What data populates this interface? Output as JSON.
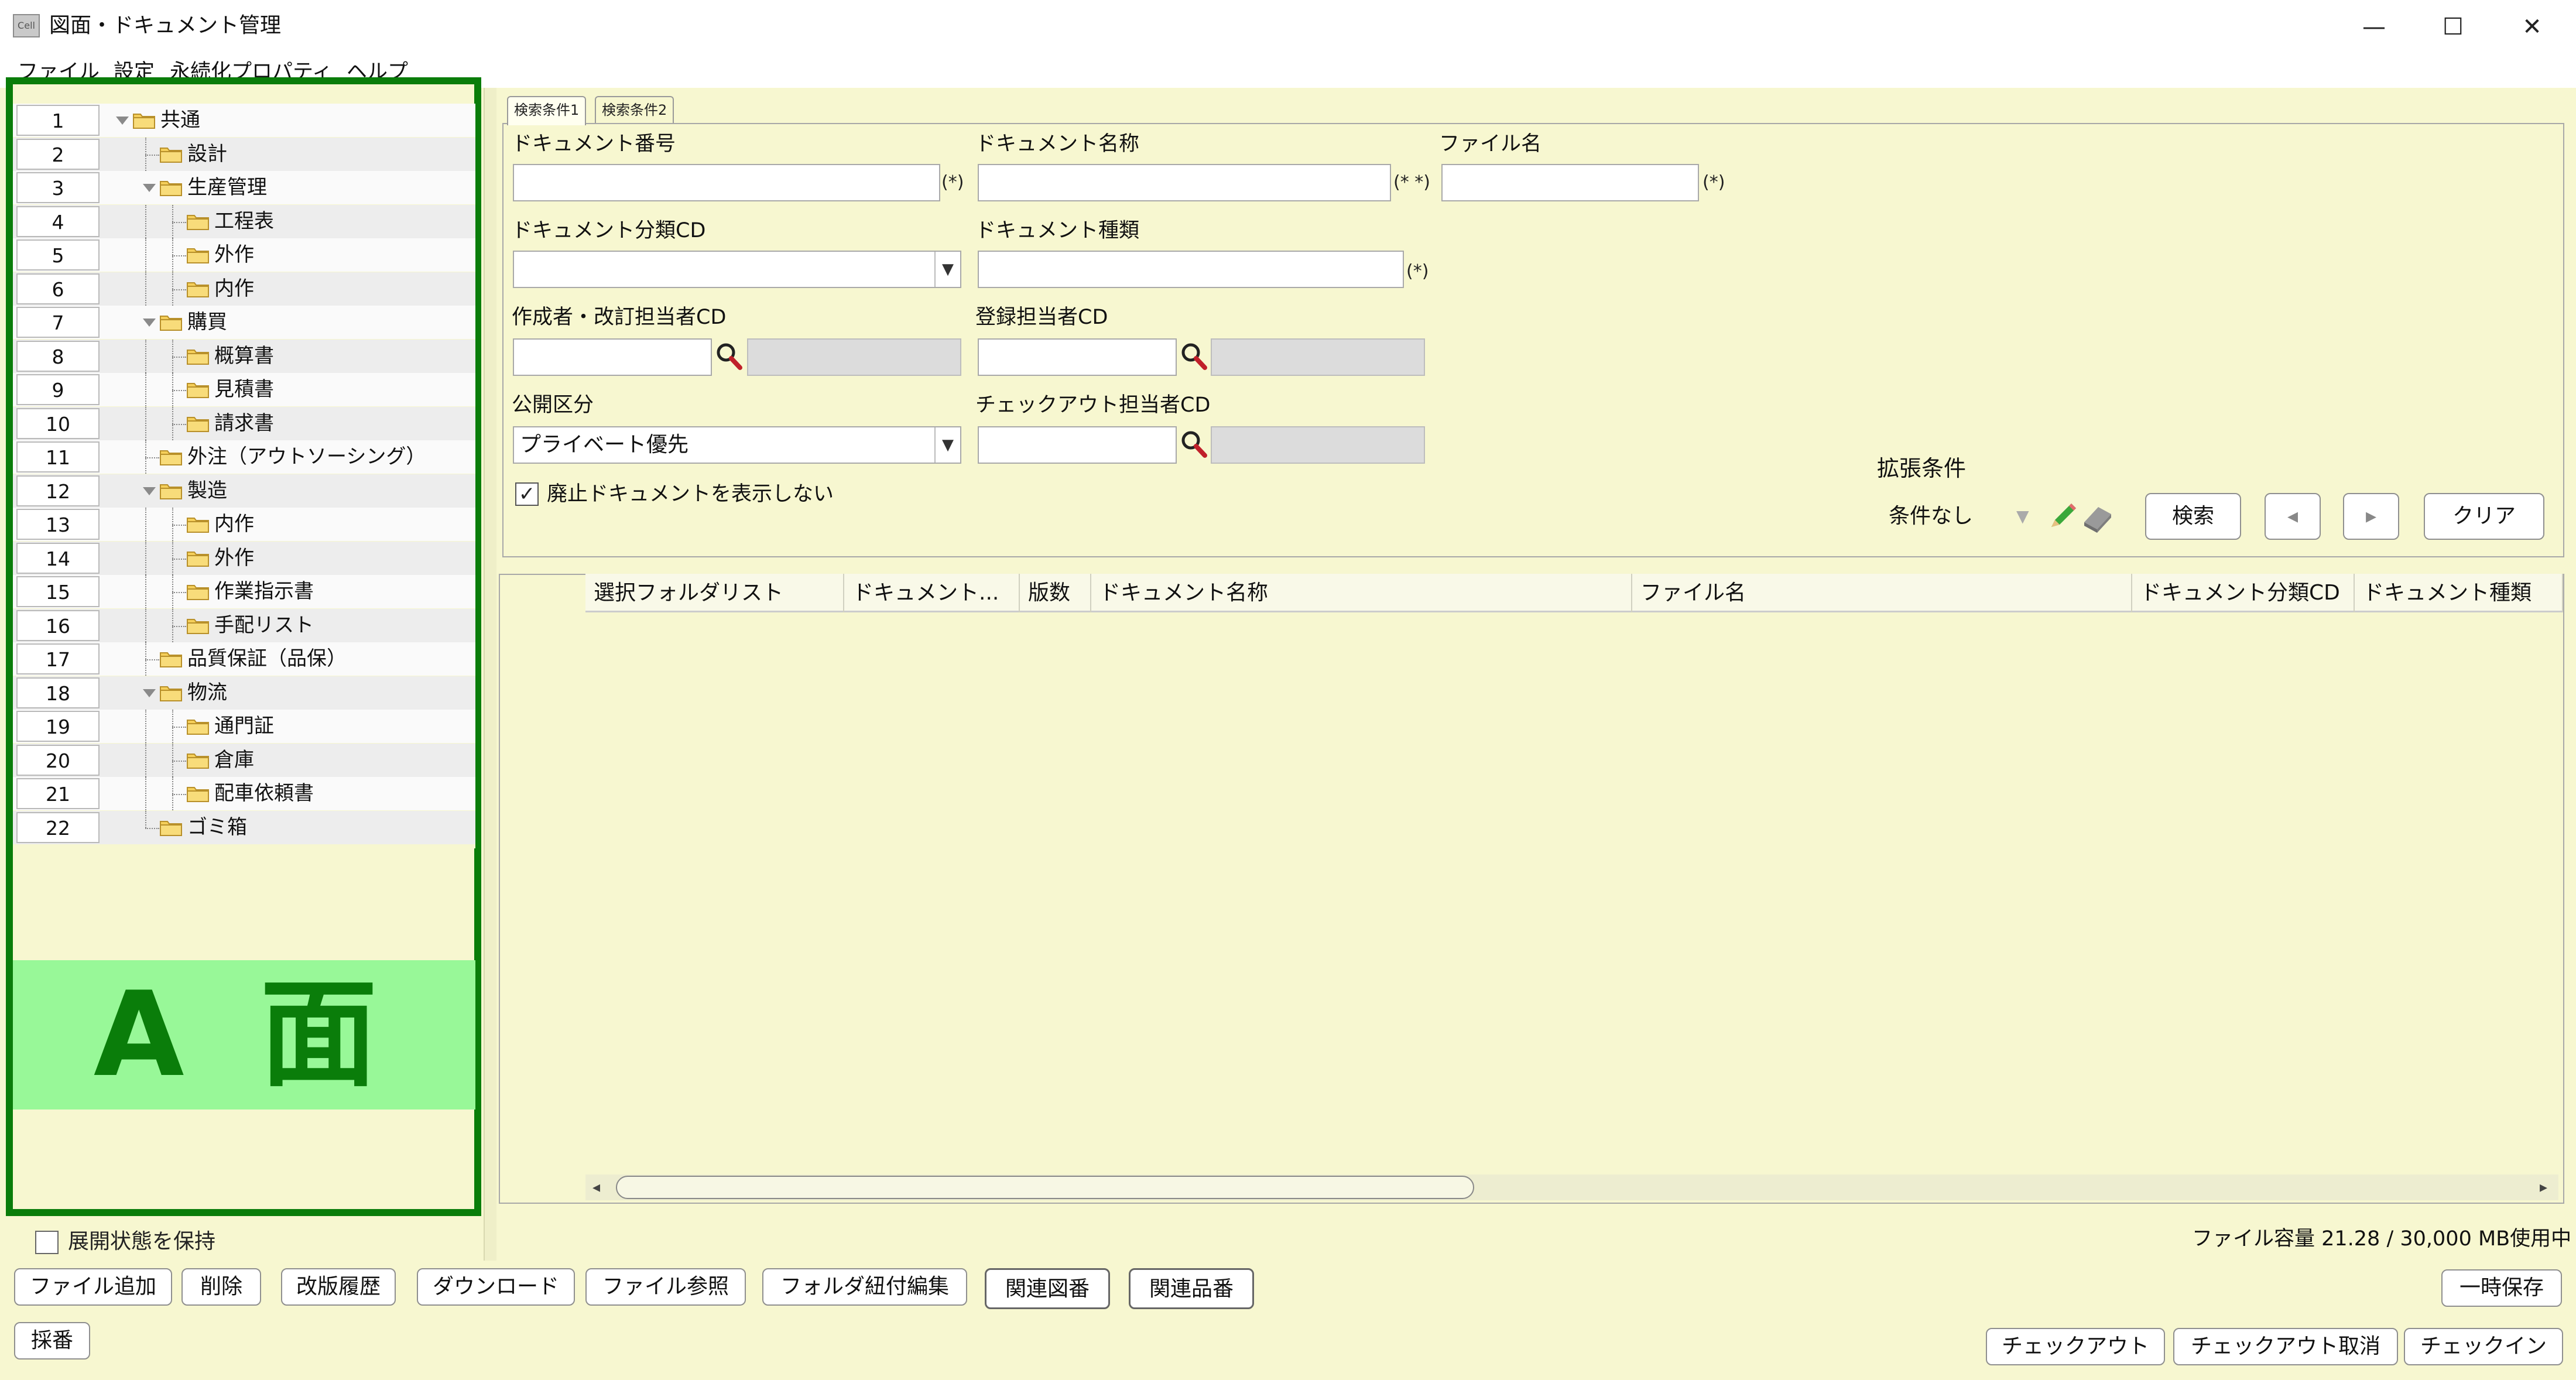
{
  "window": {
    "icon_text": "Cell",
    "title": "図面・ドキュメント管理",
    "minimize": "—",
    "maximize": "☐",
    "close": "✕"
  },
  "menu": [
    "ファイル",
    "設定",
    "永続化プロパティ",
    "ヘルプ"
  ],
  "tree": {
    "rows": [
      {
        "num": "1",
        "label": "共通"
      },
      {
        "num": "2",
        "label": "設計"
      },
      {
        "num": "3",
        "label": "生産管理"
      },
      {
        "num": "4",
        "label": "工程表"
      },
      {
        "num": "5",
        "label": "外作"
      },
      {
        "num": "6",
        "label": "内作"
      },
      {
        "num": "7",
        "label": "購買"
      },
      {
        "num": "8",
        "label": "概算書"
      },
      {
        "num": "9",
        "label": "見積書"
      },
      {
        "num": "10",
        "label": "請求書"
      },
      {
        "num": "11",
        "label": "外注（アウトソーシング）"
      },
      {
        "num": "12",
        "label": "製造"
      },
      {
        "num": "13",
        "label": "内作"
      },
      {
        "num": "14",
        "label": "外作"
      },
      {
        "num": "15",
        "label": "作業指示書"
      },
      {
        "num": "16",
        "label": "手配リスト"
      },
      {
        "num": "17",
        "label": "品質保証（品保）"
      },
      {
        "num": "18",
        "label": "物流"
      },
      {
        "num": "19",
        "label": "通門証"
      },
      {
        "num": "20",
        "label": "倉庫"
      },
      {
        "num": "21",
        "label": "配車依頼書"
      },
      {
        "num": "22",
        "label": "ゴミ箱"
      }
    ],
    "keep_expand_label": "展開状態を保持"
  },
  "side_label": "A 面",
  "search": {
    "tabs": [
      "検索条件1",
      "検索条件2"
    ],
    "doc_number_label": "ドキュメント番号",
    "doc_name_label": "ドキュメント名称",
    "file_name_label": "ファイル名",
    "doc_class_label": "ドキュメント分類CD",
    "doc_type_label": "ドキュメント種類",
    "author_label": "作成者・改訂担当者CD",
    "registrant_label": "登録担当者CD",
    "publish_label": "公開区分",
    "publish_value": "プライベート優先",
    "checkout_user_label": "チェックアウト担当者CD",
    "hint_single": "(*)",
    "hint_double": "(* *)",
    "hide_obsolete_label": "廃止ドキュメントを表示しない",
    "hide_obsolete_checked": "✓",
    "ext_condition_label": "拡張条件",
    "ext_condition_value": "条件なし",
    "search_button": "検索",
    "prev_button": "◂",
    "next_button": "▸",
    "clear_button": "クリア"
  },
  "results": {
    "columns": [
      "選択フォルダリスト",
      "ドキュメント...",
      "版数",
      "ドキュメント名称",
      "ファイル名",
      "ドキュメント分類CD",
      "ドキュメント種類"
    ]
  },
  "capacity_text": "ファイル容量  21.28  /  30,000  MB使用中",
  "buttons": {
    "add_file": "ファイル追加",
    "delete": "削除",
    "revision_history": "改版履歴",
    "download": "ダウンロード",
    "file_reference": "ファイル参照",
    "folder_link_edit": "フォルダ紐付編集",
    "related_drawing": "関連図番",
    "related_item": "関連品番",
    "temp_save": "一時保存",
    "numbering": "採番",
    "checkout": "チェックアウト",
    "checkout_cancel": "チェックアウト取消",
    "checkin": "チェックイン"
  },
  "colors": {
    "background": "#f7f7d0",
    "highlight_border": "#0a7d0a",
    "side_label_bg": "#98f898",
    "folder": "#f5cf5a"
  }
}
